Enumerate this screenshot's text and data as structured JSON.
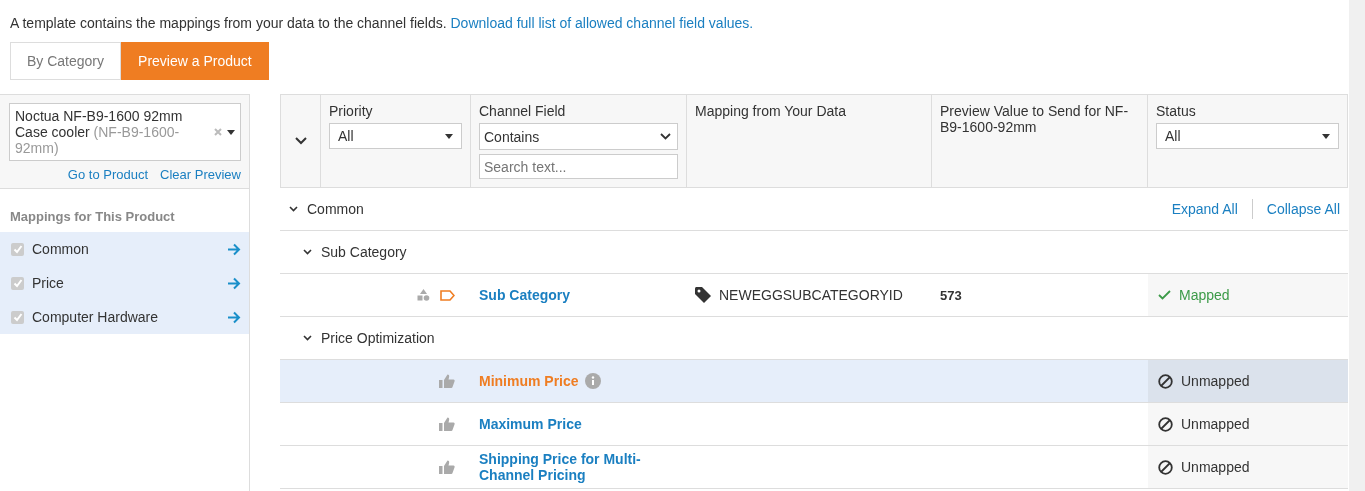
{
  "intro": {
    "text": "A template contains the mappings from your data to the channel fields.",
    "link": "Download full list of allowed channel field values."
  },
  "tabs": [
    {
      "label": "By Category",
      "selected": false
    },
    {
      "label": "Preview a Product",
      "selected": true
    }
  ],
  "product_selector": {
    "value": "Noctua NF-B9-1600 92mm Case cooler",
    "sku": "(NF-B9-1600-92mm)",
    "links": [
      "Go to Product",
      "Clear Preview"
    ]
  },
  "mappings_panel": {
    "title": "Mappings for This Product",
    "items": [
      {
        "label": "Common",
        "checked": true
      },
      {
        "label": "Price",
        "checked": true
      },
      {
        "label": "Computer Hardware",
        "checked": true
      }
    ]
  },
  "table": {
    "columns": [
      {
        "label": "Priority",
        "filter": {
          "kind": "dropdown",
          "value": "All"
        }
      },
      {
        "label": "Channel Field",
        "filter": {
          "kind": "select-search",
          "value": "Contains",
          "placeholder": "Search text..."
        }
      },
      {
        "label": "Mapping from Your Data"
      },
      {
        "label": "Preview Value to Send for NF-B9-1600-92mm"
      },
      {
        "label": "Status",
        "filter": {
          "kind": "dropdown",
          "value": "All"
        }
      }
    ],
    "actions": [
      "Expand All",
      "Collapse All"
    ],
    "groups": [
      {
        "label": "Common",
        "expanded": true,
        "children": [
          {
            "label": "Sub Category",
            "expanded": true,
            "fields": [
              {
                "kind": "category",
                "name": "Sub Category",
                "selected": false,
                "info": false,
                "mapping": "NEWEGGSUBCATEGORYID",
                "preview": "573",
                "status": {
                  "kind": "mapped",
                  "label": "Mapped"
                }
              }
            ]
          },
          {
            "label": "Price Optimization",
            "expanded": true,
            "fields": [
              {
                "kind": "price",
                "name": "Minimum Price",
                "selected": true,
                "info": true,
                "status": {
                  "kind": "unmapped",
                  "label": "Unmapped"
                }
              },
              {
                "kind": "price",
                "name": "Maximum Price",
                "selected": false,
                "info": false,
                "status": {
                  "kind": "unmapped",
                  "label": "Unmapped"
                }
              },
              {
                "kind": "price",
                "name": "Shipping Price for Multi-Channel Pricing",
                "selected": false,
                "info": false,
                "status": {
                  "kind": "unmapped",
                  "label": "Unmapped"
                }
              }
            ]
          }
        ]
      }
    ]
  }
}
